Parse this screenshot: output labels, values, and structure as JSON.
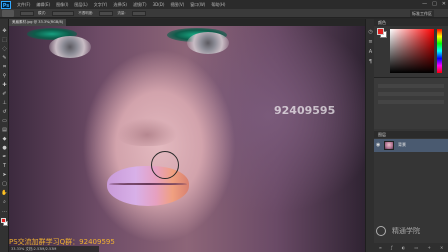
{
  "app": {
    "logo_text": "Ps"
  },
  "menu": {
    "items": [
      "文件(F)",
      "编辑(E)",
      "图像(I)",
      "图层(L)",
      "文字(Y)",
      "选择(S)",
      "滤镜(T)",
      "3D(D)",
      "视图(V)",
      "窗口(W)",
      "帮助(H)"
    ],
    "window_controls": [
      "—",
      "□",
      "✕"
    ]
  },
  "options": {
    "labels": [
      "模式:",
      "不透明度:",
      "流量:"
    ],
    "workspace": "标准工作区"
  },
  "document": {
    "tab_title": "美眉素材.jpg @ 33.3%(RGB/8)"
  },
  "canvas": {
    "watermark_qq": "92409595",
    "watermark_bottom": "PS交流加群学习Q群：92409595",
    "brand": "精通学院"
  },
  "panels": {
    "color_title": "颜色",
    "layers_title": "图层",
    "layer_name": "背景",
    "fg_color": "#e02020",
    "bg_color": "#ffffff"
  },
  "status": {
    "text": "33.33%   文档:2.53M/2.53M"
  }
}
